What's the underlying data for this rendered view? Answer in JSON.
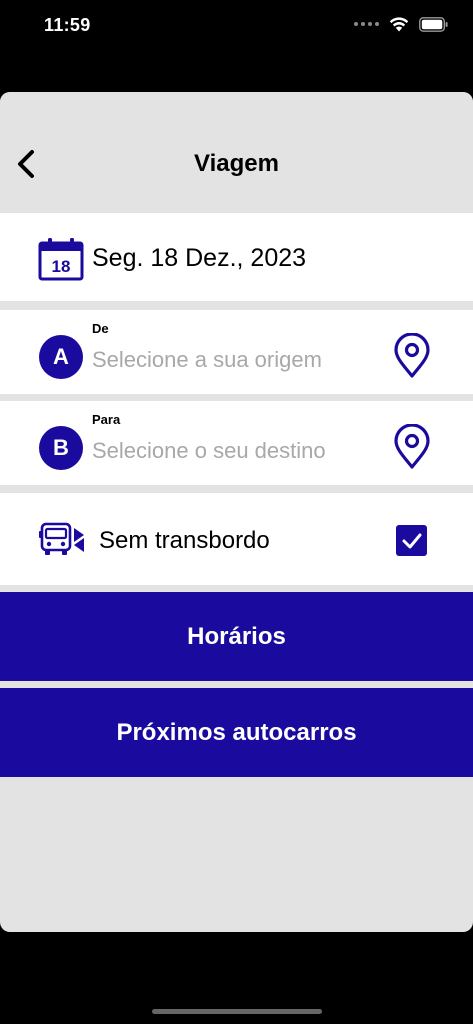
{
  "status_bar": {
    "time": "11:59"
  },
  "header": {
    "title": "Viagem",
    "back_icon": "chevron-left-icon"
  },
  "date": {
    "day_number": "18",
    "text": "Seg. 18 Dez., 2023"
  },
  "origin": {
    "badge": "A",
    "label": "De",
    "placeholder": "Selecione a sua origem",
    "value": ""
  },
  "destination": {
    "badge": "B",
    "label": "Para",
    "placeholder": "Selecione o seu destino",
    "value": ""
  },
  "transfer": {
    "label": "Sem transbordo",
    "checked": true
  },
  "buttons": {
    "schedules": "Horários",
    "next_buses": "Próximos autocarros"
  },
  "colors": {
    "accent": "#1a0a9e",
    "background": "#e3e3e3",
    "placeholder": "#a8a8a8"
  }
}
